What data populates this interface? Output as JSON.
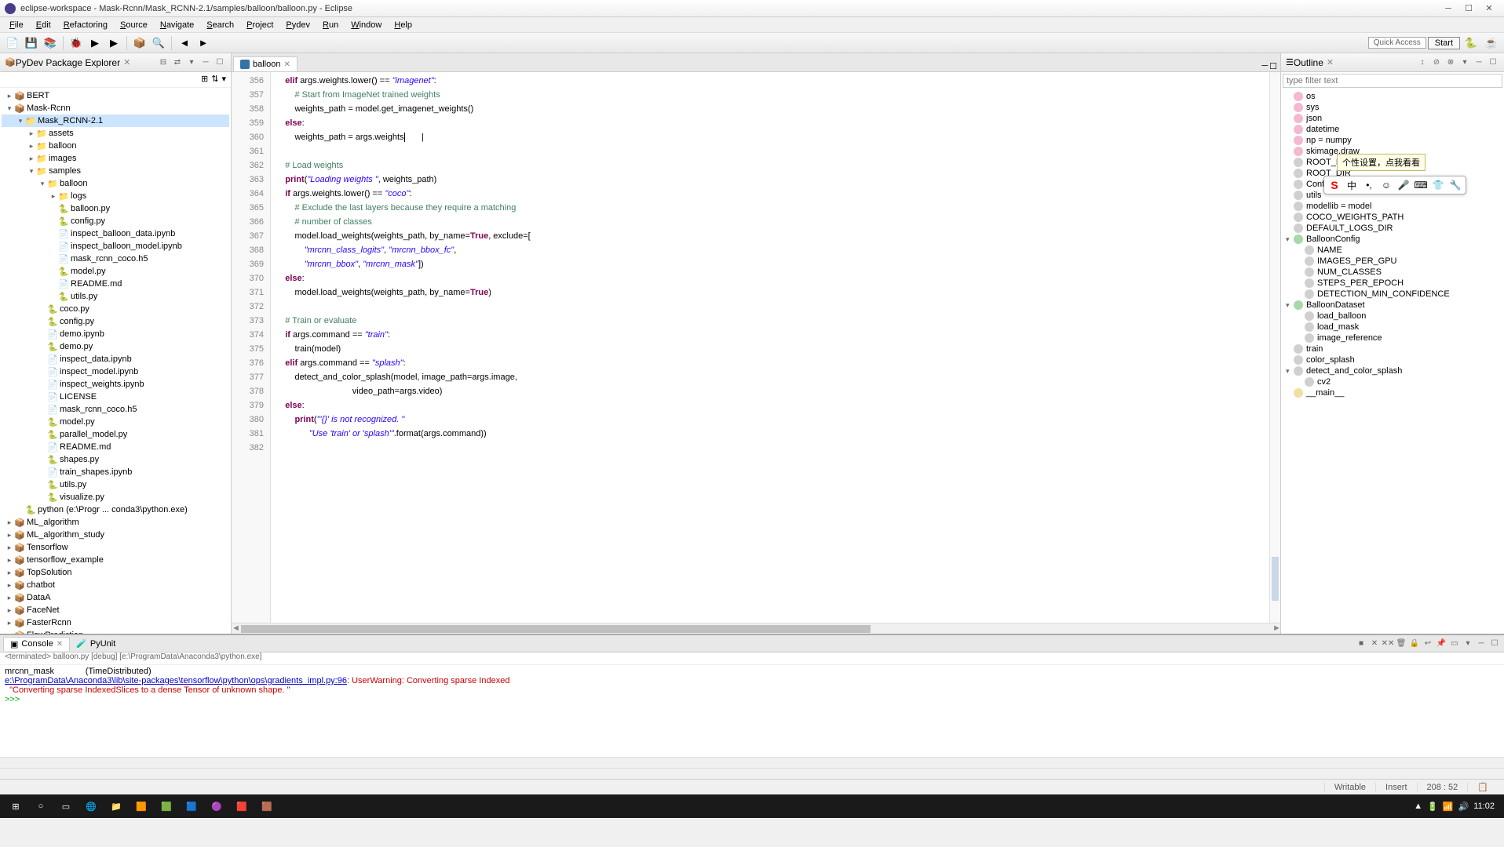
{
  "window": {
    "title": "eclipse-workspace - Mask-Rcnn/Mask_RCNN-2.1/samples/balloon/balloon.py - Eclipse"
  },
  "menu": [
    "File",
    "Edit",
    "Refactoring",
    "Source",
    "Navigate",
    "Search",
    "Project",
    "Pydev",
    "Run",
    "Window",
    "Help"
  ],
  "quick_access": "Quick Access",
  "start_btn": "Start",
  "explorer": {
    "title": "PyDev Package Explorer",
    "items": [
      {
        "depth": 0,
        "twist": "▸",
        "icon": "proj",
        "label": "BERT"
      },
      {
        "depth": 0,
        "twist": "▾",
        "icon": "proj",
        "label": "Mask-Rcnn"
      },
      {
        "depth": 1,
        "twist": "▾",
        "icon": "folder",
        "label": "Mask_RCNN-2.1",
        "selected": true
      },
      {
        "depth": 2,
        "twist": "▸",
        "icon": "folder",
        "label": "assets"
      },
      {
        "depth": 2,
        "twist": "▸",
        "icon": "folder",
        "label": "balloon"
      },
      {
        "depth": 2,
        "twist": "▸",
        "icon": "folder",
        "label": "images"
      },
      {
        "depth": 2,
        "twist": "▾",
        "icon": "folder",
        "label": "samples"
      },
      {
        "depth": 3,
        "twist": "▾",
        "icon": "folder",
        "label": "balloon"
      },
      {
        "depth": 4,
        "twist": "▸",
        "icon": "folder",
        "label": "logs"
      },
      {
        "depth": 4,
        "twist": "",
        "icon": "py",
        "label": "balloon.py"
      },
      {
        "depth": 4,
        "twist": "",
        "icon": "py",
        "label": "config.py"
      },
      {
        "depth": 4,
        "twist": "",
        "icon": "file",
        "label": "inspect_balloon_data.ipynb"
      },
      {
        "depth": 4,
        "twist": "",
        "icon": "file",
        "label": "inspect_balloon_model.ipynb"
      },
      {
        "depth": 4,
        "twist": "",
        "icon": "file",
        "label": "mask_rcnn_coco.h5"
      },
      {
        "depth": 4,
        "twist": "",
        "icon": "py",
        "label": "model.py"
      },
      {
        "depth": 4,
        "twist": "",
        "icon": "file",
        "label": "README.md"
      },
      {
        "depth": 4,
        "twist": "",
        "icon": "py",
        "label": "utils.py"
      },
      {
        "depth": 3,
        "twist": "",
        "icon": "py",
        "label": "coco.py"
      },
      {
        "depth": 3,
        "twist": "",
        "icon": "py",
        "label": "config.py"
      },
      {
        "depth": 3,
        "twist": "",
        "icon": "file",
        "label": "demo.ipynb"
      },
      {
        "depth": 3,
        "twist": "",
        "icon": "py",
        "label": "demo.py"
      },
      {
        "depth": 3,
        "twist": "",
        "icon": "file",
        "label": "inspect_data.ipynb"
      },
      {
        "depth": 3,
        "twist": "",
        "icon": "file",
        "label": "inspect_model.ipynb"
      },
      {
        "depth": 3,
        "twist": "",
        "icon": "file",
        "label": "inspect_weights.ipynb"
      },
      {
        "depth": 3,
        "twist": "",
        "icon": "file",
        "label": "LICENSE"
      },
      {
        "depth": 3,
        "twist": "",
        "icon": "file",
        "label": "mask_rcnn_coco.h5"
      },
      {
        "depth": 3,
        "twist": "",
        "icon": "py",
        "label": "model.py"
      },
      {
        "depth": 3,
        "twist": "",
        "icon": "py",
        "label": "parallel_model.py"
      },
      {
        "depth": 3,
        "twist": "",
        "icon": "file",
        "label": "README.md"
      },
      {
        "depth": 3,
        "twist": "",
        "icon": "py",
        "label": "shapes.py"
      },
      {
        "depth": 3,
        "twist": "",
        "icon": "file",
        "label": "train_shapes.ipynb"
      },
      {
        "depth": 3,
        "twist": "",
        "icon": "py",
        "label": "utils.py"
      },
      {
        "depth": 3,
        "twist": "",
        "icon": "py",
        "label": "visualize.py"
      },
      {
        "depth": 1,
        "twist": "",
        "icon": "py",
        "label": "python  (e:\\Progr ... conda3\\python.exe)"
      },
      {
        "depth": 0,
        "twist": "▸",
        "icon": "proj",
        "label": "ML_algorithm"
      },
      {
        "depth": 0,
        "twist": "▸",
        "icon": "proj",
        "label": "ML_algorithm_study"
      },
      {
        "depth": 0,
        "twist": "▸",
        "icon": "proj",
        "label": "Tensorflow"
      },
      {
        "depth": 0,
        "twist": "▸",
        "icon": "proj",
        "label": "tensorflow_example"
      },
      {
        "depth": 0,
        "twist": "▸",
        "icon": "proj",
        "label": "TopSolution"
      },
      {
        "depth": 0,
        "twist": "▸",
        "icon": "proj",
        "label": "chatbot"
      },
      {
        "depth": 0,
        "twist": "▸",
        "icon": "proj",
        "label": "DataA"
      },
      {
        "depth": 0,
        "twist": "▸",
        "icon": "proj",
        "label": "FaceNet"
      },
      {
        "depth": 0,
        "twist": "▸",
        "icon": "proj",
        "label": "FasterRcnn"
      },
      {
        "depth": 0,
        "twist": "▸",
        "icon": "proj",
        "label": "FlowPrediction"
      }
    ]
  },
  "editor": {
    "tab": "balloon",
    "first_line": 356,
    "lines": [
      [
        {
          "t": "    "
        },
        {
          "t": "elif",
          "c": "kw"
        },
        {
          "t": " args.weights.lower() == "
        },
        {
          "t": "\"imagenet\"",
          "c": "str"
        },
        {
          "t": ":"
        }
      ],
      [
        {
          "t": "        "
        },
        {
          "t": "# Start from ImageNet trained weights",
          "c": "cmt"
        }
      ],
      [
        {
          "t": "        weights_path = model.get_imagenet_weights()"
        }
      ],
      [
        {
          "t": "    "
        },
        {
          "t": "else",
          "c": "kw"
        },
        {
          "t": ":"
        }
      ],
      [
        {
          "t": "        weights_path = args.weights"
        },
        {
          "t": "       |",
          "c": "cursor-mark"
        }
      ],
      [
        {
          "t": ""
        }
      ],
      [
        {
          "t": "    "
        },
        {
          "t": "# Load weights",
          "c": "cmt"
        }
      ],
      [
        {
          "t": "    "
        },
        {
          "t": "print",
          "c": "kw"
        },
        {
          "t": "("
        },
        {
          "t": "\"Loading weights \"",
          "c": "str"
        },
        {
          "t": ", weights_path)"
        }
      ],
      [
        {
          "t": "    "
        },
        {
          "t": "if",
          "c": "kw"
        },
        {
          "t": " args.weights.lower() == "
        },
        {
          "t": "\"coco\"",
          "c": "str"
        },
        {
          "t": ":"
        }
      ],
      [
        {
          "t": "        "
        },
        {
          "t": "# Exclude the last layers because they require a matching",
          "c": "cmt"
        }
      ],
      [
        {
          "t": "        "
        },
        {
          "t": "# number of classes",
          "c": "cmt"
        }
      ],
      [
        {
          "t": "        model.load_weights(weights_path, by_name="
        },
        {
          "t": "True",
          "c": "bool"
        },
        {
          "t": ", exclude=["
        }
      ],
      [
        {
          "t": "            "
        },
        {
          "t": "\"mrcnn_class_logits\"",
          "c": "str"
        },
        {
          "t": ", "
        },
        {
          "t": "\"mrcnn_bbox_fc\"",
          "c": "str"
        },
        {
          "t": ","
        }
      ],
      [
        {
          "t": "            "
        },
        {
          "t": "\"mrcnn_bbox\"",
          "c": "str"
        },
        {
          "t": ", "
        },
        {
          "t": "\"mrcnn_mask\"",
          "c": "str"
        },
        {
          "t": "])"
        }
      ],
      [
        {
          "t": "    "
        },
        {
          "t": "else",
          "c": "kw"
        },
        {
          "t": ":"
        }
      ],
      [
        {
          "t": "        model.load_weights(weights_path, by_name="
        },
        {
          "t": "True",
          "c": "bool"
        },
        {
          "t": ")"
        }
      ],
      [
        {
          "t": ""
        }
      ],
      [
        {
          "t": "    "
        },
        {
          "t": "# Train or evaluate",
          "c": "cmt"
        }
      ],
      [
        {
          "t": "    "
        },
        {
          "t": "if",
          "c": "kw"
        },
        {
          "t": " args.command == "
        },
        {
          "t": "\"train\"",
          "c": "str"
        },
        {
          "t": ":"
        }
      ],
      [
        {
          "t": "        train(model)"
        }
      ],
      [
        {
          "t": "    "
        },
        {
          "t": "elif",
          "c": "kw"
        },
        {
          "t": " args.command == "
        },
        {
          "t": "\"splash\"",
          "c": "str"
        },
        {
          "t": ":"
        }
      ],
      [
        {
          "t": "        detect_and_color_splash(model, image_path=args.image,"
        }
      ],
      [
        {
          "t": "                                video_path=args.video)"
        }
      ],
      [
        {
          "t": "    "
        },
        {
          "t": "else",
          "c": "kw"
        },
        {
          "t": ":"
        }
      ],
      [
        {
          "t": "        "
        },
        {
          "t": "print",
          "c": "kw"
        },
        {
          "t": "("
        },
        {
          "t": "\"'{}' is not recognized. \"",
          "c": "str"
        }
      ],
      [
        {
          "t": "              "
        },
        {
          "t": "\"Use 'train' or 'splash'\"",
          "c": "str"
        },
        {
          "t": ".format(args.command))"
        }
      ],
      [
        {
          "t": ""
        }
      ]
    ]
  },
  "outline": {
    "title": "Outline",
    "filter_placeholder": "type filter text",
    "tooltip": "个性设置，点我看看",
    "items": [
      {
        "depth": 0,
        "t": "",
        "b": "pink",
        "label": "os"
      },
      {
        "depth": 0,
        "t": "",
        "b": "pink",
        "label": "sys"
      },
      {
        "depth": 0,
        "t": "",
        "b": "pink",
        "label": "json"
      },
      {
        "depth": 0,
        "t": "",
        "b": "pink",
        "label": "datetime"
      },
      {
        "depth": 0,
        "t": "",
        "b": "pink",
        "label": "np = numpy"
      },
      {
        "depth": 0,
        "t": "",
        "b": "pink",
        "label": "skimage.draw"
      },
      {
        "depth": 0,
        "t": "",
        "b": "gray",
        "label": "ROOT_DIR"
      },
      {
        "depth": 0,
        "t": "",
        "b": "gray",
        "label": "ROOT_DIR"
      },
      {
        "depth": 0,
        "t": "",
        "b": "gray",
        "label": "Config (config"
      },
      {
        "depth": 0,
        "t": "",
        "b": "gray",
        "label": "utils"
      },
      {
        "depth": 0,
        "t": "",
        "b": "gray",
        "label": "modellib = model"
      },
      {
        "depth": 0,
        "t": "",
        "b": "gray",
        "label": "COCO_WEIGHTS_PATH"
      },
      {
        "depth": 0,
        "t": "",
        "b": "gray",
        "label": "DEFAULT_LOGS_DIR"
      },
      {
        "depth": 0,
        "t": "▾",
        "b": "grn",
        "label": "BalloonConfig"
      },
      {
        "depth": 1,
        "t": "",
        "b": "gray",
        "label": "NAME"
      },
      {
        "depth": 1,
        "t": "",
        "b": "gray",
        "label": "IMAGES_PER_GPU"
      },
      {
        "depth": 1,
        "t": "",
        "b": "gray",
        "label": "NUM_CLASSES"
      },
      {
        "depth": 1,
        "t": "",
        "b": "gray",
        "label": "STEPS_PER_EPOCH"
      },
      {
        "depth": 1,
        "t": "",
        "b": "gray",
        "label": "DETECTION_MIN_CONFIDENCE"
      },
      {
        "depth": 0,
        "t": "▾",
        "b": "grn",
        "label": "BalloonDataset"
      },
      {
        "depth": 1,
        "t": "",
        "b": "gray",
        "label": "load_balloon"
      },
      {
        "depth": 1,
        "t": "",
        "b": "gray",
        "label": "load_mask"
      },
      {
        "depth": 1,
        "t": "",
        "b": "gray",
        "label": "image_reference"
      },
      {
        "depth": 0,
        "t": "",
        "b": "gray",
        "label": "train"
      },
      {
        "depth": 0,
        "t": "",
        "b": "gray",
        "label": "color_splash"
      },
      {
        "depth": 0,
        "t": "▾",
        "b": "gray",
        "label": "detect_and_color_splash"
      },
      {
        "depth": 1,
        "t": "",
        "b": "gray",
        "label": "cv2"
      },
      {
        "depth": 0,
        "t": "",
        "b": "yel",
        "label": "__main__"
      }
    ]
  },
  "console": {
    "tab1": "Console",
    "tab2": "PyUnit",
    "subtitle": "<terminated> balloon.py [debug] [e:\\ProgramData\\Anaconda3\\python.exe]",
    "lines": [
      [
        {
          "t": "mrcnn_mask             (TimeDistributed)"
        }
      ],
      [
        {
          "t": "e:\\ProgramData\\Anaconda3\\lib\\site-packages\\tensorflow\\python\\ops\\gradients_impl.py:96",
          "c": "link"
        },
        {
          "t": ": UserWarning: Converting sparse Indexed",
          "c": "err"
        }
      ],
      [
        {
          "t": "  \"Converting sparse IndexedSlices to a dense Tensor of unknown shape. \"",
          "c": "err"
        }
      ],
      [
        {
          "t": ""
        }
      ],
      [
        {
          "t": ""
        }
      ],
      [
        {
          "t": ">>> ",
          "c": "prompt"
        }
      ]
    ]
  },
  "status": {
    "writable": "Writable",
    "insert": "Insert",
    "pos": "208 : 52"
  },
  "taskbar": {
    "time": "11:02"
  }
}
